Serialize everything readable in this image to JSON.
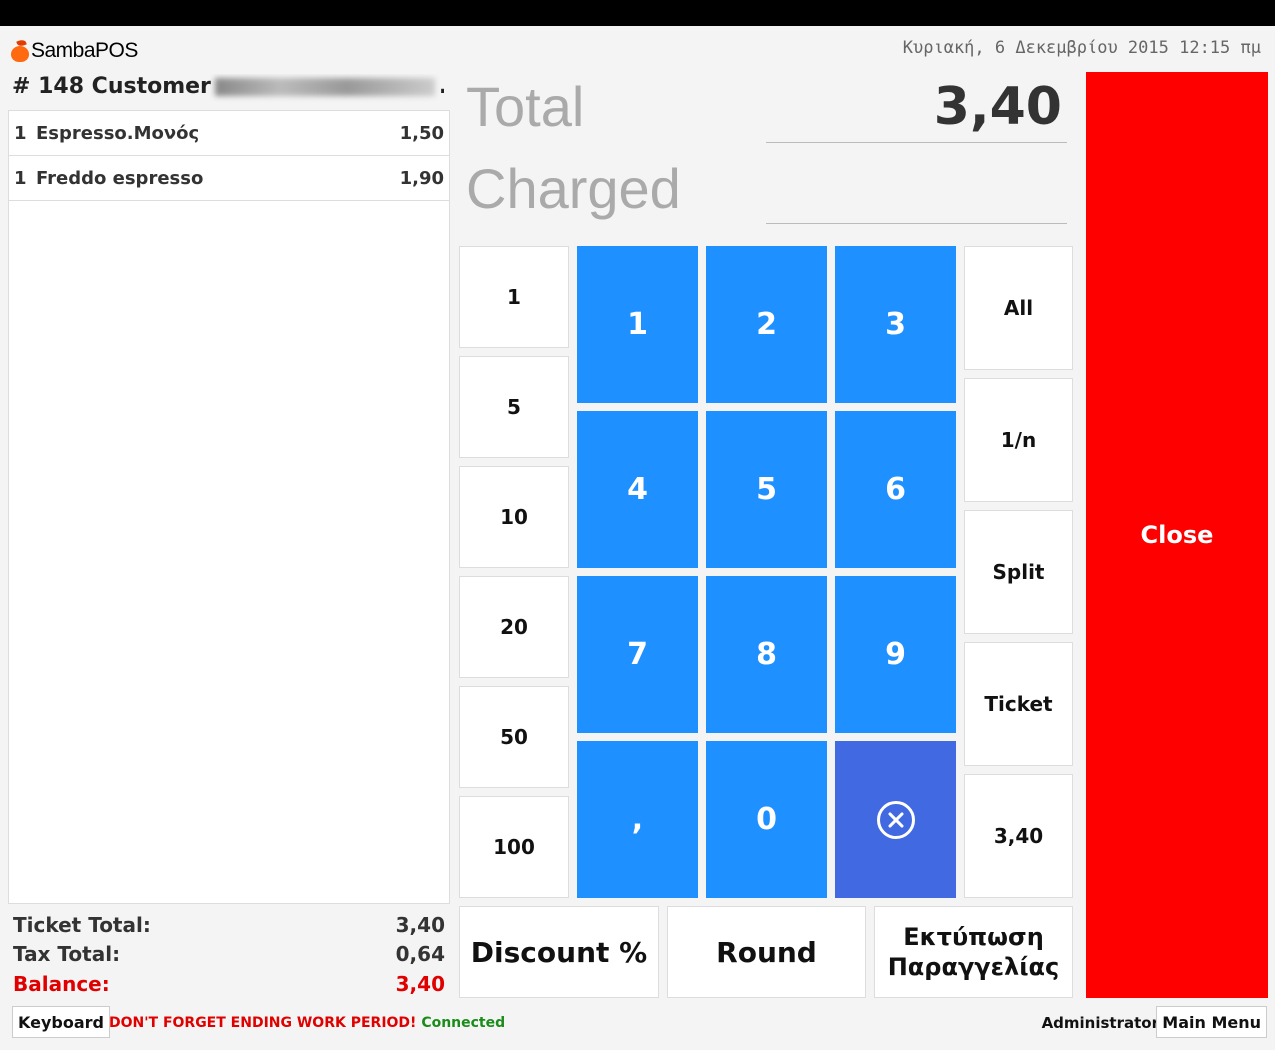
{
  "app": {
    "logo_text": "SambaPOS"
  },
  "header": {
    "datetime": "Κυριακή, 6 Δεκεμβρίου 2015 12:15 πμ"
  },
  "ticket": {
    "title_prefix": "# 148 Customer",
    "title_suffix": "...",
    "orders": [
      {
        "qty": "1",
        "name": "Espresso.Μονός",
        "price": "1,50"
      },
      {
        "qty": "1",
        "name": "Freddo espresso",
        "price": "1,90"
      }
    ],
    "totals": {
      "ticket_total_label": "Ticket Total:",
      "ticket_total": "3,40",
      "tax_total_label": "Tax Total:",
      "tax_total": "0,64",
      "balance_label": "Balance:",
      "balance": "3,40"
    }
  },
  "payment": {
    "total_label": "Total",
    "total_value": "3,40",
    "charged_label": "Charged",
    "charged_value": ""
  },
  "quick_amounts": [
    "1",
    "5",
    "10",
    "20",
    "50",
    "100"
  ],
  "keypad": {
    "k1": "1",
    "k2": "2",
    "k3": "3",
    "k4": "4",
    "k5": "5",
    "k6": "6",
    "k7": "7",
    "k8": "8",
    "k9": "9",
    "comma": ",",
    "k0": "0"
  },
  "split_buttons": [
    "All",
    "1/n",
    "Split",
    "Ticket",
    "3,40"
  ],
  "bottom_buttons": {
    "discount": "Discount %",
    "round": "Round",
    "print_line1": "Εκτύπωση",
    "print_line2": "Παραγγελίας"
  },
  "close_label": "Close",
  "status": {
    "keyboard": "Keyboard",
    "warning": "DON'T FORGET ENDING WORK PERIOD!",
    "connection": "Connected",
    "user": "Administrator",
    "main_menu": "Main Menu"
  },
  "colors": {
    "keypad_blue": "#1e90ff",
    "clear_blue": "#4169e1",
    "close_red": "#ff0000",
    "warning_red": "#e00000",
    "connected_green": "#1a8c1a"
  }
}
